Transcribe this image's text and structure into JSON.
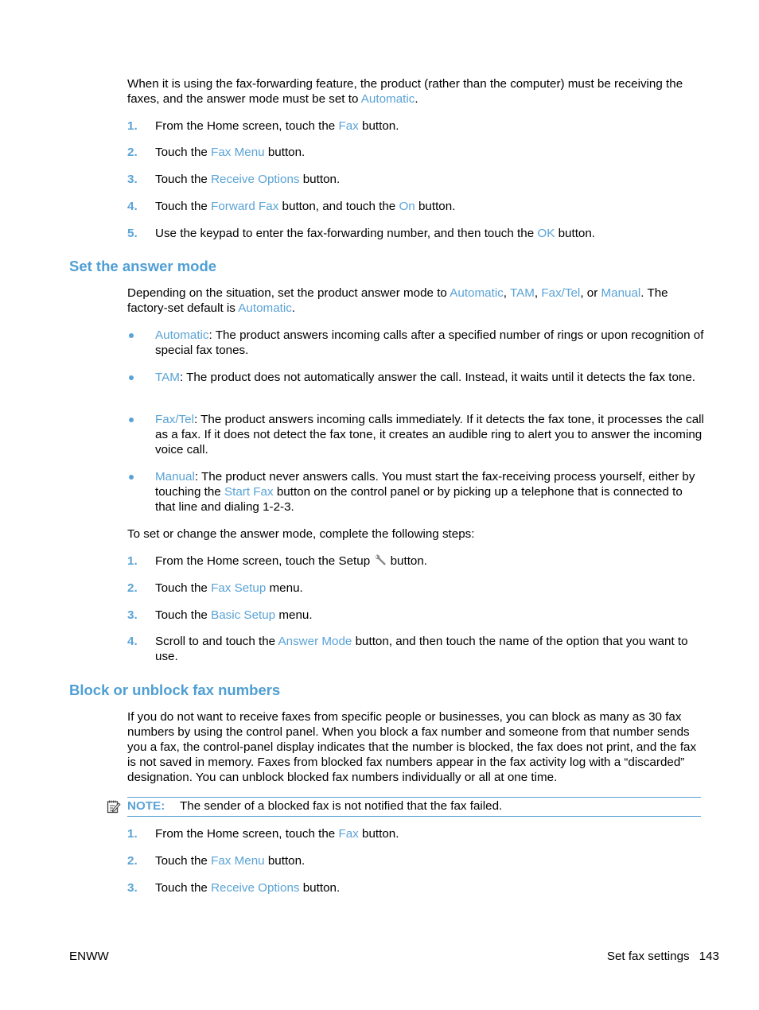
{
  "intro": {
    "text_before": "When it is using the fax-forwarding feature, the product (rather than the computer) must be receiving the faxes, and the answer mode must be set to ",
    "link": "Automatic",
    "text_after": "."
  },
  "forward_steps": [
    {
      "num": "1.",
      "pre": "From the Home screen, touch the ",
      "link": "Fax",
      "post": " button."
    },
    {
      "num": "2.",
      "pre": "Touch the ",
      "link": "Fax Menu",
      "post": " button."
    },
    {
      "num": "3.",
      "pre": "Touch the ",
      "link": "Receive Options",
      "post": " button."
    },
    {
      "num": "4.",
      "pre": "Touch the ",
      "link": "Forward Fax",
      "mid": " button, and touch the ",
      "link2": "On",
      "post": " button."
    },
    {
      "num": "5.",
      "pre": "Use the keypad to enter the fax-forwarding number, and then touch the ",
      "link": "OK",
      "post": " button."
    }
  ],
  "answer_mode": {
    "heading": "Set the answer mode",
    "intro": {
      "t1": "Depending on the situation, set the product answer mode to ",
      "l1": "Automatic",
      "t2": ", ",
      "l2": "TAM",
      "t3": ", ",
      "l3": "Fax/Tel",
      "t4": ", or ",
      "l4": "Manual",
      "t5": ". The factory-set default is ",
      "l5": "Automatic",
      "t6": "."
    },
    "bullets": [
      {
        "link": "Automatic",
        "text": ": The product answers incoming calls after a specified number of rings or upon recognition of special fax tones."
      },
      {
        "link": "TAM",
        "text": ": The product does not automatically answer the call. Instead, it waits until it detects the fax tone."
      },
      {
        "link": "Fax/Tel",
        "text": ": The product answers incoming calls immediately. If it detects the fax tone, it processes the call as a fax. If it does not detect the fax tone, it creates an audible ring to alert you to answer the incoming voice call."
      },
      {
        "link": "Manual",
        "text": ": The product never answers calls. You must start the fax-receiving process yourself, either by touching the ",
        "link2": "Start Fax",
        "text2": " button on the control panel or by picking up a telephone that is connected to that line and dialing 1-2-3."
      }
    ],
    "steps_intro": "To set or change the answer mode, complete the following steps:",
    "steps": [
      {
        "num": "1.",
        "pre": "From the Home screen, touch the Setup ",
        "icon": "wrench-icon",
        "post": " button."
      },
      {
        "num": "2.",
        "pre": "Touch the ",
        "link": "Fax Setup",
        "post": " menu."
      },
      {
        "num": "3.",
        "pre": "Touch the ",
        "link": "Basic Setup",
        "post": " menu."
      },
      {
        "num": "4.",
        "pre": "Scroll to and touch the ",
        "link": "Answer Mode",
        "post": " button, and then touch the name of the option that you want to use."
      }
    ]
  },
  "block": {
    "heading": "Block or unblock fax numbers",
    "intro": "If you do not want to receive faxes from specific people or businesses, you can block as many as 30 fax numbers by using the control panel. When you block a fax number and someone from that number sends you a fax, the control-panel display indicates that the number is blocked, the fax does not print, and the fax is not saved in memory. Faxes from blocked fax numbers appear in the fax activity log with a “discarded” designation. You can unblock blocked fax numbers individually or all at one time.",
    "note": {
      "icon": "note-icon",
      "label": "NOTE:",
      "text": "The sender of a blocked fax is not notified that the fax failed."
    },
    "steps": [
      {
        "num": "1.",
        "pre": "From the Home screen, touch the ",
        "link": "Fax",
        "post": " button."
      },
      {
        "num": "2.",
        "pre": "Touch the ",
        "link": "Fax Menu",
        "post": " button."
      },
      {
        "num": "3.",
        "pre": "Touch the ",
        "link": "Receive Options",
        "post": " button."
      }
    ]
  },
  "footer": {
    "left": "ENWW",
    "section": "Set fax settings",
    "page_number": "143"
  },
  "colors": {
    "accent": "#5aa3d6",
    "heading": "#4f9fd4",
    "text": "#000000"
  }
}
